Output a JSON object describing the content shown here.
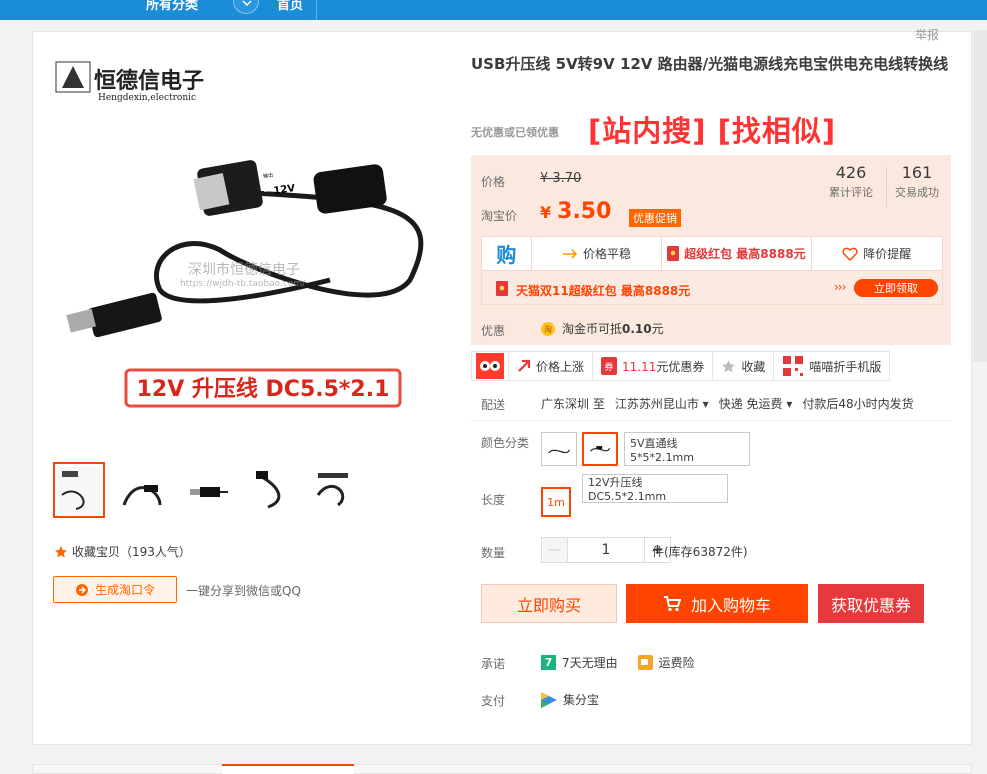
{
  "topnav": {
    "category": "所有分类",
    "home": "首页"
  },
  "report": "举报",
  "product": {
    "title": "USB升压线 5V转9V 12V 路由器/光猫电源线充电宝供电充电线转换线",
    "no_coupon": "无优惠或已领优惠",
    "search_links": "[站内搜] [找相似]"
  },
  "image": {
    "brand": "恒德信电子",
    "brand_en": "Hengdexin,electronic",
    "watermark": "深圳市恒德信电子",
    "watermark_url": "https://wjdh-tb.taobao.com/",
    "adapter_label": "12V",
    "adapter_small": "输出",
    "caption": "12V 升压线 DC5.5*2.1"
  },
  "price": {
    "price_label": "价格",
    "original": "¥ 3.70",
    "tb_label": "淘宝价",
    "currency": "¥",
    "value": "3.50",
    "promo_tag": "优惠促销",
    "reviews": "426",
    "reviews_label": "累计评论",
    "sold": "161",
    "sold_label": "交易成功"
  },
  "tools": {
    "buy_icon": "购",
    "trend": "价格平稳",
    "redpack": "超级红包 最高8888元",
    "alert": "降价提醒"
  },
  "promo": {
    "text": "天猫双11超级红包 最高8888元",
    "arrows": "›››",
    "button": "立即领取"
  },
  "discount": {
    "label": "优惠",
    "text_prefix": "淘金币可抵",
    "amount": "0.10",
    "unit": "元"
  },
  "actions": {
    "price_up": "价格上涨",
    "coupon_date": "11.11",
    "coupon_text": "元优惠券",
    "collect": "收藏",
    "mobile": "喵喵折手机版"
  },
  "shipping": {
    "label": "配送",
    "from": "广东深圳 至",
    "to": "江苏苏州昆山市",
    "method": "快递 免运费",
    "time": "付款后48小时内发货"
  },
  "sku": {
    "color_label": "颜色分类",
    "option_a": "5V直通线 5*5*2.1mm",
    "option_b": "12V升压线 DC5.5*2.1mm",
    "length_label": "长度",
    "length": "1m"
  },
  "quantity": {
    "label": "数量",
    "value": "1",
    "minus": "—",
    "plus": "+",
    "stock": "件(库存63872件)"
  },
  "buttons": {
    "buy_now": "立即购买",
    "add_cart": "加入购物车",
    "get_coupon": "获取优惠券"
  },
  "service": {
    "promise_label": "承诺",
    "return_policy": "7天无理由",
    "return_icon": "7",
    "freight": "运费险",
    "pay_label": "支付",
    "pay_method": "集分宝"
  },
  "left": {
    "favorite": "收藏宝贝（193人气）",
    "share_button": "生成淘口令",
    "share_text": "一键分享到微信或QQ"
  },
  "colors": {
    "accent": "#ff4400",
    "nav": "#1a8cd8",
    "price_bg": "#fbe9df"
  }
}
